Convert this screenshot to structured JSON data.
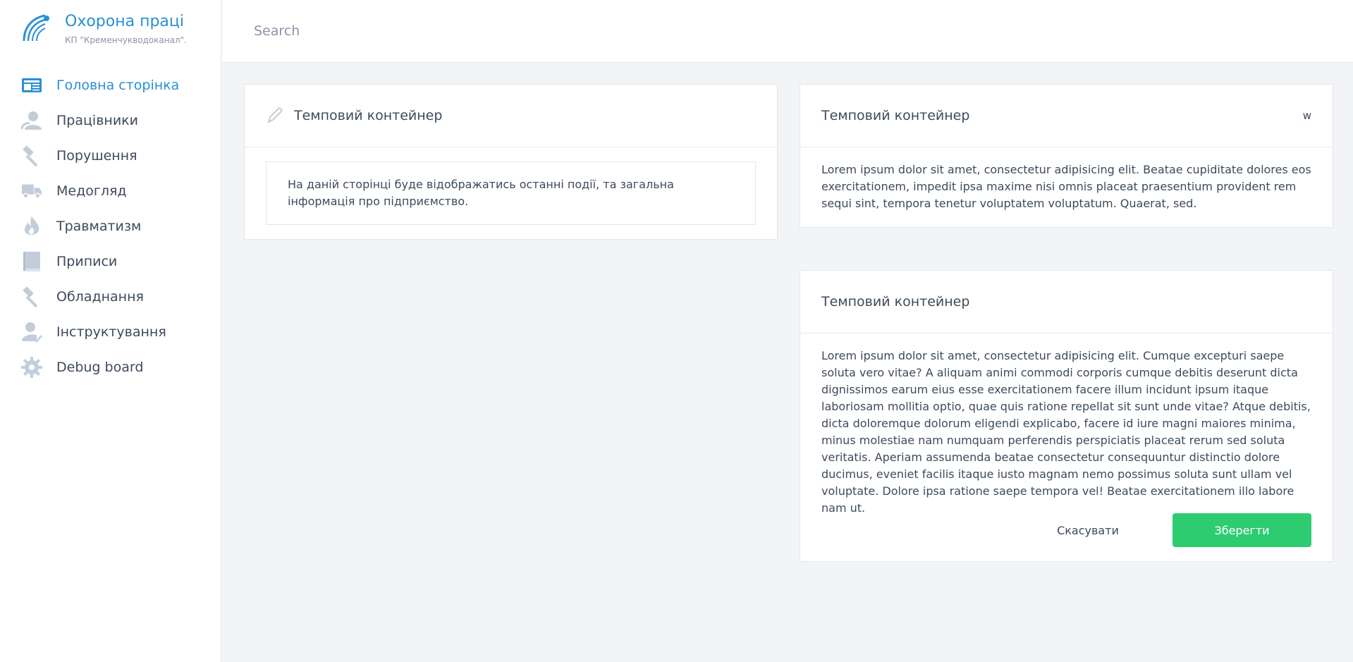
{
  "brand": {
    "title": "Охорона праці",
    "subtitle": "КП \"Кременчукводоканал\"."
  },
  "sidebar": {
    "items": [
      {
        "label": "Головна сторінка",
        "icon": "newspaper-icon",
        "active": true
      },
      {
        "label": "Працівники",
        "icon": "users-icon"
      },
      {
        "label": "Порушення",
        "icon": "hammer-icon"
      },
      {
        "label": "Медогляд",
        "icon": "truck-icon"
      },
      {
        "label": "Травматизм",
        "icon": "fire-icon"
      },
      {
        "label": "Приписи",
        "icon": "book-icon"
      },
      {
        "label": "Обладнання",
        "icon": "hammer-icon"
      },
      {
        "label": "Інструктування",
        "icon": "user-check-icon"
      },
      {
        "label": "Debug board",
        "icon": "gear-icon"
      }
    ]
  },
  "search": {
    "placeholder": "Search"
  },
  "cards": {
    "info": {
      "title": "Темповий контейнер",
      "text": "На даній сторінці буде відображатись останні події, та загальна інформація про підприємство."
    },
    "short": {
      "title": "Темповий контейнер",
      "badge": "w",
      "text": "Lorem ipsum dolor sit amet, consectetur adipisicing elit. Beatae cupiditate dolores eos exercitationem, impedit ipsa maxime nisi omnis placeat praesentium provident rem sequi sint, tempora tenetur voluptatem voluptatum. Quaerat, sed."
    },
    "form": {
      "title": "Темповий контейнер",
      "text": "Lorem ipsum dolor sit amet, consectetur adipisicing elit. Cumque excepturi saepe soluta vero vitae? A aliquam animi commodi corporis cumque debitis deserunt dicta dignissimos earum eius esse exercitationem facere illum incidunt ipsum itaque laboriosam mollitia optio, quae quis ratione repellat sit sunt unde vitae? Atque debitis, dicta doloremque dolorum eligendi explicabo, facere id iure magni maiores minima, minus molestiae nam numquam perferendis perspiciatis placeat rerum sed soluta veritatis. Aperiam assumenda beatae consectetur consequuntur distinctio dolore ducimus, eveniet facilis itaque iusto magnam nemo possimus soluta sunt ullam vel voluptate. Dolore ipsa ratione saepe tempora vel! Beatae exercitationem illo labore nam ut.",
      "cancel_label": "Скасувати",
      "save_label": "Зберегти"
    }
  },
  "colors": {
    "accent": "#2a8fd4",
    "success": "#2ecc71",
    "icon": "#c3cdd9"
  }
}
